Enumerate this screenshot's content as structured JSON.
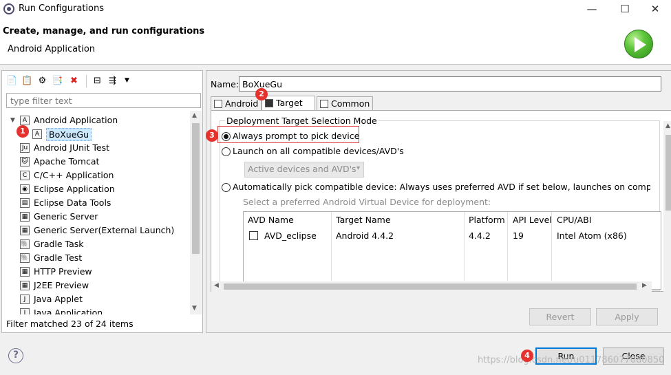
{
  "window": {
    "title": "Run Configurations",
    "minimize": "—",
    "maximize": "☐",
    "close": "✕"
  },
  "header": {
    "title": "Create, manage, and run configurations",
    "subtitle": "Android Application"
  },
  "left": {
    "filter_placeholder": "type filter text",
    "tree": [
      {
        "label": "Android Application",
        "icon": "android-app-icon",
        "expanded": true
      },
      {
        "label": "BoXueGu",
        "icon": "android-config-icon",
        "selected": true
      },
      {
        "label": "Android JUnit Test",
        "icon": "junit-icon"
      },
      {
        "label": "Apache Tomcat",
        "icon": "tomcat-icon"
      },
      {
        "label": "C/C++ Application",
        "icon": "cpp-icon"
      },
      {
        "label": "Eclipse Application",
        "icon": "eclipse-icon"
      },
      {
        "label": "Eclipse Data Tools",
        "icon": "data-tools-icon"
      },
      {
        "label": "Generic Server",
        "icon": "server-icon"
      },
      {
        "label": "Generic Server(External Launch)",
        "icon": "server-icon"
      },
      {
        "label": "Gradle Task",
        "icon": "gradle-icon"
      },
      {
        "label": "Gradle Test",
        "icon": "gradle-icon"
      },
      {
        "label": "HTTP Preview",
        "icon": "http-icon"
      },
      {
        "label": "J2EE Preview",
        "icon": "j2ee-icon"
      },
      {
        "label": "Java Applet",
        "icon": "applet-icon"
      },
      {
        "label": "Java Application",
        "icon": "java-app-icon"
      }
    ],
    "status": "Filter matched 23 of 24 items"
  },
  "right": {
    "name_label": "Name:",
    "name_value": "BoXueGu",
    "tabs": [
      {
        "label": "Android"
      },
      {
        "label": "Target",
        "active": true
      },
      {
        "label": "Common"
      }
    ],
    "group_title": "Deployment Target Selection Mode",
    "radio_always": "Always prompt to pick device",
    "radio_launch_all": "Launch on all compatible devices/AVD's",
    "combo_value": "Active devices and AVD's",
    "radio_auto": "Automatically pick compatible device: Always uses preferred AVD if set below, launches on compatible d",
    "avd_label": "Select a preferred Android Virtual Device for deployment:",
    "table": {
      "headers": [
        "AVD Name",
        "Target Name",
        "Platform",
        "API Level",
        "CPU/ABI"
      ],
      "row": [
        "AVD_eclipse",
        "Android 4.4.2",
        "4.4.2",
        "19",
        "Intel Atom (x86)"
      ]
    },
    "revert": "Revert",
    "apply": "Apply"
  },
  "footer": {
    "run": "Run",
    "close": "Close",
    "help": "?",
    "watermark": "https://blog.csdn.net/u011786077080850"
  },
  "callouts": [
    "1",
    "2",
    "3",
    "4"
  ]
}
